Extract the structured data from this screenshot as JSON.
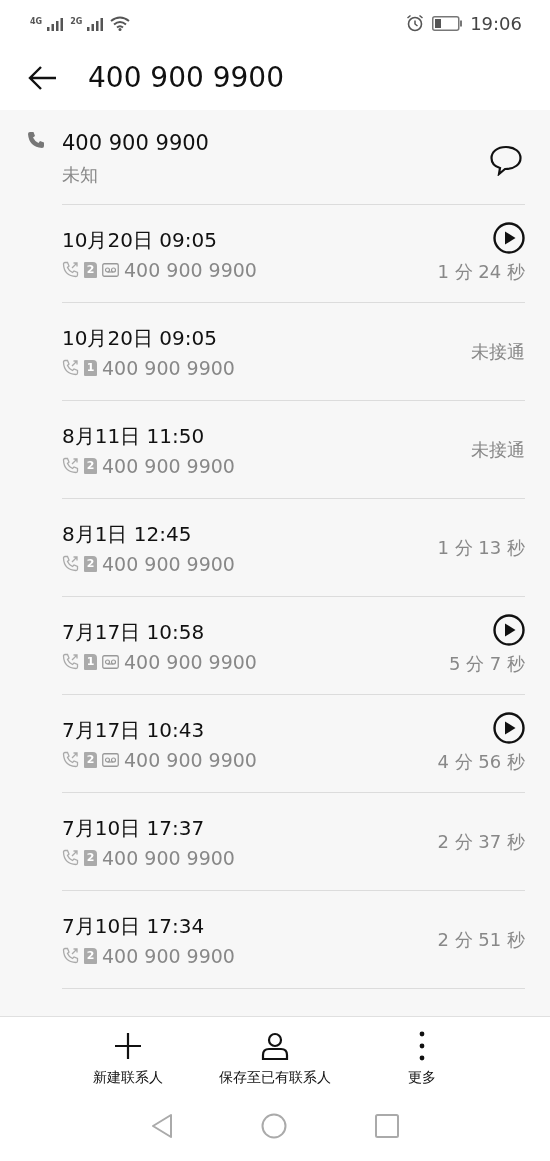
{
  "status_bar": {
    "network_1": "4G",
    "network_2": "2G",
    "time": "19:06"
  },
  "header": {
    "title": "400 900 9900"
  },
  "contact": {
    "number": "400 900 9900",
    "label": "未知"
  },
  "calls": [
    {
      "date": "10月20日 09:05",
      "sim": "2",
      "recorded": true,
      "number": "400 900 9900",
      "result": "1 分 24 秒"
    },
    {
      "date": "10月20日 09:05",
      "sim": "1",
      "recorded": false,
      "number": "400 900 9900",
      "result": "未接通"
    },
    {
      "date": "8月11日 11:50",
      "sim": "2",
      "recorded": false,
      "number": "400 900 9900",
      "result": "未接通"
    },
    {
      "date": "8月1日 12:45",
      "sim": "2",
      "recorded": false,
      "number": "400 900 9900",
      "result": "1 分 13 秒"
    },
    {
      "date": "7月17日 10:58",
      "sim": "1",
      "recorded": true,
      "number": "400 900 9900",
      "result": "5 分 7 秒"
    },
    {
      "date": "7月17日 10:43",
      "sim": "2",
      "recorded": true,
      "number": "400 900 9900",
      "result": "4 分 56 秒"
    },
    {
      "date": "7月10日 17:37",
      "sim": "2",
      "recorded": false,
      "number": "400 900 9900",
      "result": "2 分 37 秒"
    },
    {
      "date": "7月10日 17:34",
      "sim": "2",
      "recorded": false,
      "number": "400 900 9900",
      "result": "2 分 51 秒"
    }
  ],
  "actions": [
    {
      "kind": "add",
      "label": "新建联系人"
    },
    {
      "kind": "person",
      "label": "保存至已有联系人"
    },
    {
      "kind": "more",
      "label": "更多"
    }
  ]
}
